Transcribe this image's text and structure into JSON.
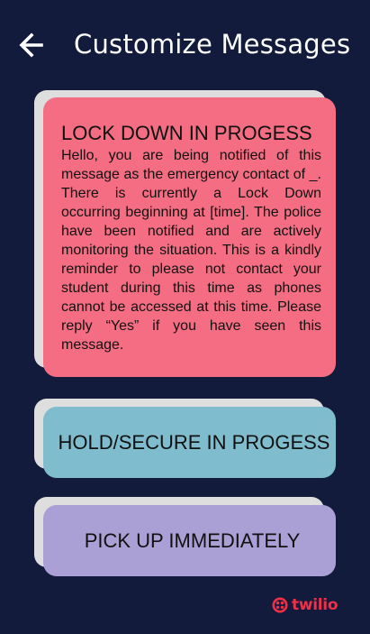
{
  "header": {
    "title": "Customize Messages",
    "back_icon": "arrow-left-icon"
  },
  "messages": [
    {
      "heading": "LOCK DOWN IN PROGESS",
      "body": "Hello, you are being notified of this message as the emergency contact of _. There is currently a Lock Down occurring beginning at [time]. The police have been notified and are actively monitoring the situation. This is a kindly reminder to please not contact your student during this time as phones cannot be accessed at this time. Please reply “Yes” if you have seen this message.",
      "color": "#f46d83"
    },
    {
      "heading": "HOLD/SECURE IN PROGESS",
      "color": "#7fbcce"
    },
    {
      "heading": "PICK UP IMMEDIATELY",
      "color": "#aba0d5"
    }
  ],
  "footer": {
    "logo_text": "twilio",
    "logo_icon": "twilio-logo-icon",
    "brand_color": "#f22f46"
  },
  "colors": {
    "background": "#121b3b",
    "card_shadow": "#dedede"
  }
}
